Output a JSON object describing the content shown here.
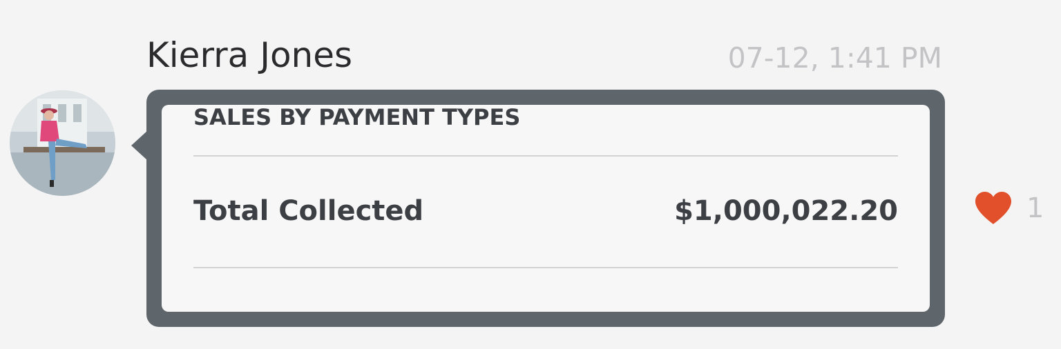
{
  "message": {
    "sender_name": "Kierra Jones",
    "timestamp": "07-12, 1:41 PM"
  },
  "card": {
    "title": "SALES BY PAYMENT TYPES",
    "rows": [
      {
        "label": "Total Collected",
        "value": "$1,000,022.20"
      }
    ]
  },
  "reaction": {
    "icon": "heart-icon",
    "count": "1",
    "color": "#e2502b"
  },
  "colors": {
    "bubble_border": "#5e656b",
    "card_background": "#f7f7f7",
    "background": "#f4f4f4"
  }
}
